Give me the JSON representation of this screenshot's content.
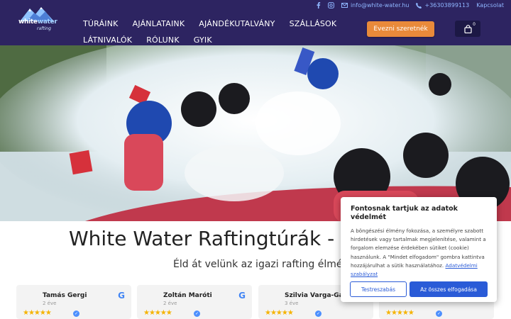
{
  "topbar": {
    "email": "info@white-water.hu",
    "phone": "+36303899113",
    "contact": "Kapcsolat"
  },
  "logo": {
    "brand_white": "white",
    "brand_water": "water",
    "sub": "rafting"
  },
  "nav": {
    "row1": [
      "TÚRÁINK",
      "AJÁNLATAINK",
      "AJÁNDÉKUTALVÁNY",
      "SZÁLLÁSOK"
    ],
    "row2": [
      "LÁTNIVALÓK",
      "RÓLUNK",
      "GYIK"
    ]
  },
  "cta": {
    "label": "Evezni szeretnék"
  },
  "cart": {
    "count": "0"
  },
  "hero": {
    "title": "White Water Raftingtúrák - Ev",
    "subtitle": "Éld át velünk az igazi rafting élményt!"
  },
  "reviews": [
    {
      "name": "Tamás Gergi",
      "ago": "2 éve",
      "stars": "★★★★★"
    },
    {
      "name": "Zoltán Maróti",
      "ago": "2 éve",
      "stars": "★★★★★"
    },
    {
      "name": "Szilvia Varga-Gál",
      "ago": "3 éve",
      "stars": "★★★★★"
    },
    {
      "name": "",
      "ago": "",
      "stars": "★★★★★"
    }
  ],
  "cookie": {
    "title": "Fontosnak tartjuk az adatok védelmét",
    "body": "A böngészési élmény fokozása, a személyre szabott hirdetések vagy tartalmak megjelenítése, valamint a forgalom elemzése érdekében sütiket (cookie) használunk. A \"Mindet elfogadom\" gombra kattintva hozzájárulhat a sütik használatához.",
    "link": "Adatvédelmi szabályzat",
    "customize": "Testreszabás",
    "accept_all": "Az összes elfogadása"
  },
  "colors": {
    "header": "#2d2461",
    "accent": "#e98a3a",
    "link": "#2a5bd7",
    "star": "#f5b301"
  }
}
